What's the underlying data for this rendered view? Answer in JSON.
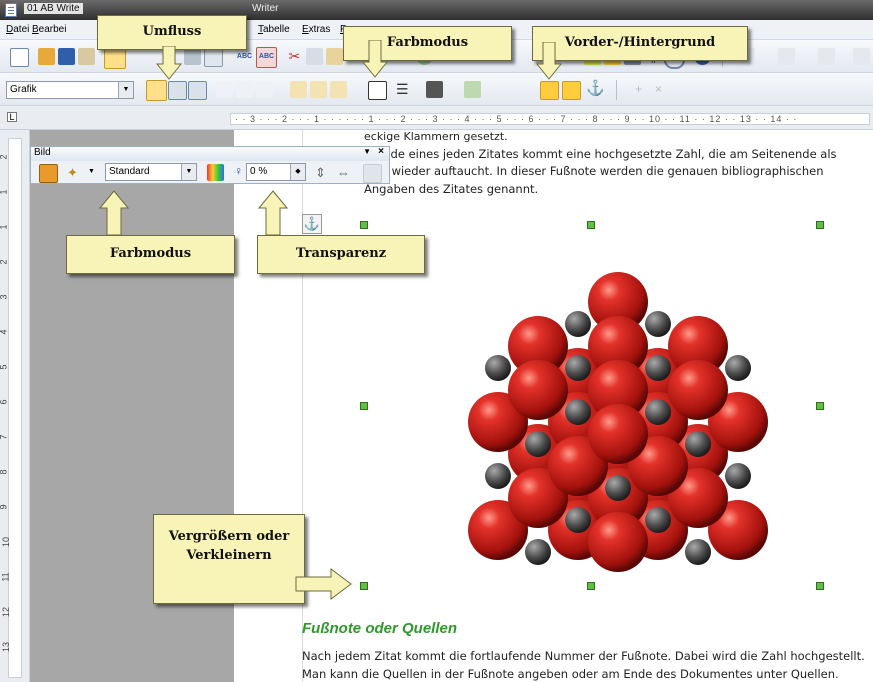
{
  "window": {
    "title_left": "01 AB Write",
    "title_right": "Writer"
  },
  "menu": [
    "Datei",
    "Bearbei",
    "Tabelle",
    "Extras",
    "F"
  ],
  "toolbar2": {
    "style_select": "Grafik"
  },
  "ruler": {
    "scale_text": "· · 3 · · · 2 · · · 1 · · ·   · · · 1 · · · 2 · · · 3 · · · 4 · · · 5 · · · 6 · · · 7 · · · 8 · · · 9 · · 10 · · 11 · · 12 · · 13 · · 14 · ·"
  },
  "vruler_numbers": [
    "2",
    "1",
    "1",
    "2",
    "3",
    "4",
    "5",
    "6",
    "7",
    "8",
    "9",
    "10",
    "11",
    "12",
    "13"
  ],
  "bild_toolbar": {
    "title": "Bild",
    "color_mode": "Standard",
    "transparency": "0 %"
  },
  "document": {
    "lines": [
      "eckige Klammern gesetzt.",
      "Ende eines jeden Zitates kommt eine hochgesetzte Zahl, die am Seitenende als",
      "note wieder auftaucht. In dieser Fußnote werden die genauen bibliographischen",
      "Angaben des Zitates genannt."
    ],
    "heading": "Fußnote oder Quellen",
    "para2": [
      "Nach jedem Zitat kommt die fortlaufende Nummer der Fußnote. Dabei wird die Zahl hochgestellt.",
      "Man kann die Quellen in der Fußnote angeben oder am Ende des Dokumentes unter Quellen."
    ]
  },
  "callouts": {
    "umfluss": "Umfluss",
    "farbmodus_top": "Farbmodus",
    "vorder_hinter": "Vorder-/Hintergrund",
    "farbmodus_bottom": "Farbmodus",
    "transparenz": "Transparenz",
    "resize": "Vergrößern oder Verkleinern"
  },
  "colors": {
    "callout_bg": "#f8f3b7",
    "heading_green": "#2d9a2a",
    "sphere_red": "#c8201a",
    "sphere_gray": "#555555"
  }
}
